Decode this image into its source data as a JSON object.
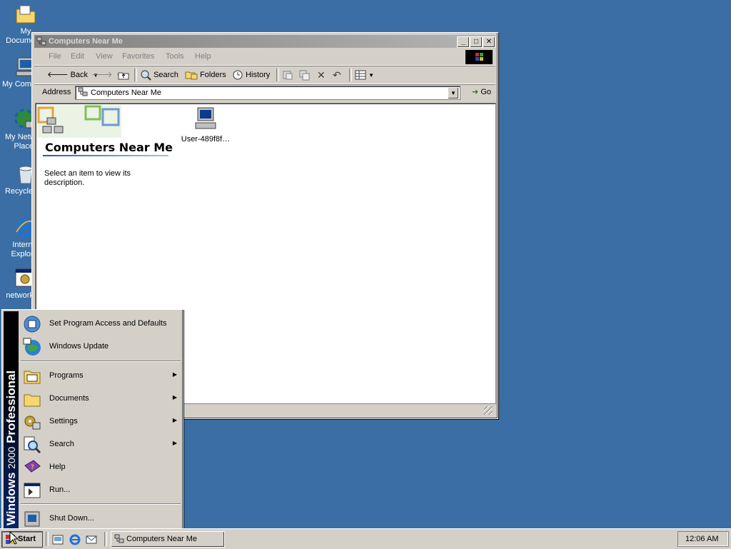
{
  "desktop": {
    "icons": [
      {
        "label": "My Documents",
        "icon": "folder-icon"
      },
      {
        "label": "My Computer",
        "icon": "computer-icon"
      },
      {
        "label": "My Network Places",
        "icon": "network-icon"
      },
      {
        "label": "Recycle Bin",
        "icon": "recycle-bin-icon"
      },
      {
        "label": "Internet Explorer",
        "icon": "ie-icon"
      },
      {
        "label": "networking",
        "icon": "program-icon"
      }
    ]
  },
  "window": {
    "title": "Computers Near Me",
    "menu": [
      "File",
      "Edit",
      "View",
      "Favorites",
      "Tools",
      "Help"
    ],
    "toolbar": {
      "back": "Back",
      "search": "Search",
      "folders": "Folders",
      "history": "History"
    },
    "address": {
      "label": "Address",
      "value": "Computers Near Me",
      "go": "Go"
    },
    "panel": {
      "title": "Computers Near Me",
      "description": "Select an item to view its description."
    },
    "items": [
      {
        "label": "User-489f8f…",
        "icon": "computer-icon"
      }
    ]
  },
  "start_menu": {
    "banner": {
      "brand": "Windows",
      "version": "2000",
      "edition": "Professional"
    },
    "top_items": [
      {
        "label": "Set Program Access and Defaults",
        "icon": "program-access-icon"
      },
      {
        "label": "Windows Update",
        "icon": "windows-update-icon"
      }
    ],
    "items": [
      {
        "label": "Programs",
        "icon": "programs-icon",
        "submenu": true
      },
      {
        "label": "Documents",
        "icon": "documents-icon",
        "submenu": true
      },
      {
        "label": "Settings",
        "icon": "settings-icon",
        "submenu": true
      },
      {
        "label": "Search",
        "icon": "search-icon",
        "submenu": true
      },
      {
        "label": "Help",
        "icon": "help-icon",
        "submenu": false
      },
      {
        "label": "Run...",
        "icon": "run-icon",
        "submenu": false
      }
    ],
    "shutdown": {
      "label": "Shut Down...",
      "icon": "shutdown-icon"
    }
  },
  "taskbar": {
    "start": "Start",
    "task": "Computers Near Me",
    "clock": "12:06 AM"
  },
  "colors": {
    "desktop": "#3a6ea5",
    "inactive_title": "#808080",
    "face": "#d4d0c8"
  }
}
